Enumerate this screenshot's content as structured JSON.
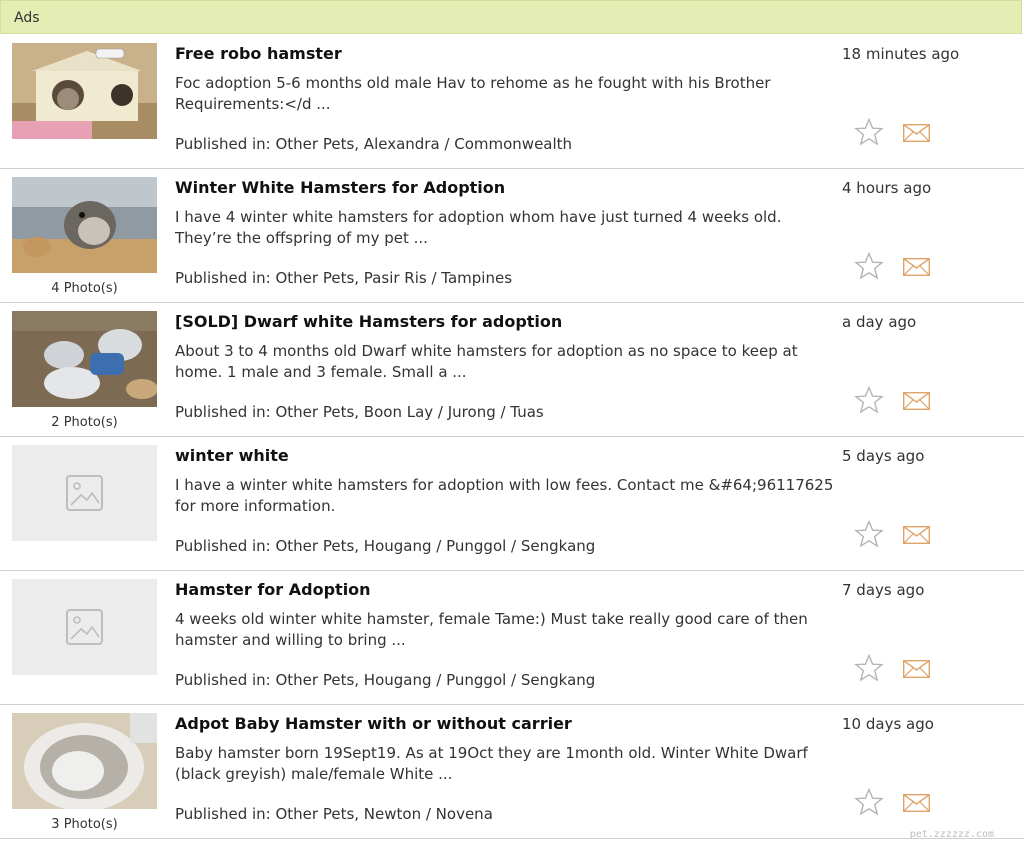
{
  "header": {
    "label": "Ads"
  },
  "listings": [
    {
      "title": "Free robo hamster",
      "desc": "Foc adoption 5-6 months old male Hav to rehome as he fought with his Brother Requirements:</d  ...",
      "published": "Published in: Other Pets, Alexandra / Commonwealth",
      "time": "18 minutes ago",
      "photos": "",
      "thumb": "house"
    },
    {
      "title": "Winter White Hamsters for Adoption",
      "desc": "I have 4 winter white hamsters for adoption whom have just turned 4 weeks old. They’re the offspring of my pet  ...",
      "published": "Published in: Other Pets, Pasir Ris / Tampines",
      "time": "4 hours ago",
      "photos": "4 Photo(s)",
      "thumb": "photo"
    },
    {
      "title": "[SOLD] Dwarf white Hamsters for adoption",
      "desc": "About 3 to 4 months old Dwarf white hamsters for adoption as no space to keep at home. 1 male and 3 female. Small a  ...",
      "published": "Published in: Other Pets, Boon Lay / Jurong / Tuas",
      "time": "a day ago",
      "photos": "2 Photo(s)",
      "thumb": "photo"
    },
    {
      "title": "winter white",
      "desc": "I have a winter white hamsters for adoption with low fees. Contact me &#64;96117625 for more information.",
      "published": "Published in: Other Pets, Hougang / Punggol / Sengkang",
      "time": "5 days ago",
      "photos": "",
      "thumb": "placeholder"
    },
    {
      "title": "Hamster for Adoption",
      "desc": "4 weeks old winter white hamster, female Tame:) Must take really good care of then hamster and willing to bring   ...",
      "published": "Published in: Other Pets, Hougang / Punggol / Sengkang",
      "time": "7 days ago",
      "photos": "",
      "thumb": "placeholder"
    },
    {
      "title": "Adpot Baby Hamster with or without carrier",
      "desc": "Baby hamster born 19Sept19. As at 19Oct they are 1month old. Winter White Dwarf (black greyish) male/female White  ...",
      "published": "Published in: Other Pets, Newton / Novena",
      "time": "10 days ago",
      "photos": "3 Photo(s)",
      "thumb": "photo"
    }
  ],
  "watermark": "pet.zzzzzz.com",
  "icons": {
    "favorite": "star-icon",
    "contact": "envelope-icon",
    "placeholder": "image-placeholder-icon"
  },
  "colors": {
    "header_bg": "#e3edb4",
    "mail": "#e0a36a",
    "star": "#b5b5b5"
  }
}
